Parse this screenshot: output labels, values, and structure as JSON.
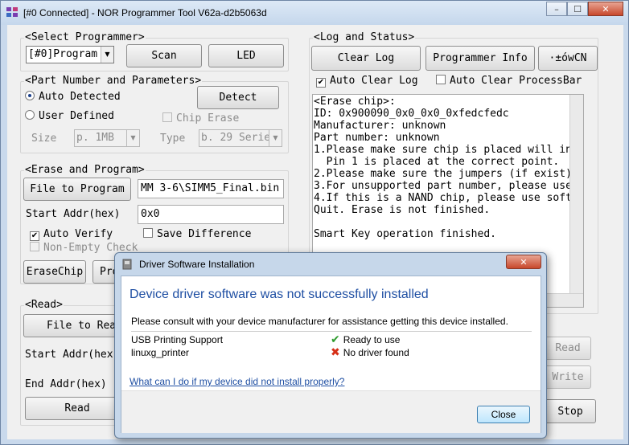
{
  "window": {
    "title": "[#0 Connected] - NOR Programmer Tool V62a-d2b5063d",
    "minimize": "–",
    "maximize": "☐",
    "close": "✕"
  },
  "select_programmer": {
    "legend": "<Select Programmer>",
    "selected": "[#0]Program",
    "scan": "Scan",
    "led": "LED"
  },
  "part": {
    "legend": "<Part Number and Parameters>",
    "auto_detected": "Auto Detected",
    "detect": "Detect",
    "user_defined": "User Defined",
    "chip_erase": "Chip Erase",
    "size_label": "Size",
    "size_value": "p. 1MB",
    "type_label": "Type",
    "type_value": "b. 29 Serie"
  },
  "erase_program": {
    "legend": "<Erase and Program>",
    "file_to_program": "File to Program",
    "file_path": "MM 3-6\\SIMM5_Final.bin",
    "start_addr_label": "Start Addr(hex)",
    "start_addr_value": "0x0",
    "auto_verify": "Auto Verify",
    "save_difference": "Save Difference",
    "non_empty_check": "Non-Empty Check",
    "erase_chip": "EraseChip",
    "program": "Pro"
  },
  "read": {
    "legend": "<Read>",
    "file_to_read": "File to Rea",
    "start_addr_label": "Start Addr(hex",
    "end_addr_label": "End Addr(hex)",
    "read": "Read"
  },
  "log": {
    "legend": "<Log and Status>",
    "clear_log": "Clear Log",
    "programmer_info": "Programmer Info",
    "garbled_button": "·±ówCN",
    "auto_clear_log": "Auto Clear Log",
    "auto_clear_processbar": "Auto Clear ProcessBar",
    "lines": [
      "<Erase chip>:",
      "ID: 0x900090_0x0_0x0_0xfedcfedc",
      "Manufacturer: unknown",
      "Part number: unknown",
      "1.Please make sure chip is placed will in",
      "  Pin 1 is placed at the correct point.",
      "2.Please make sure the jumpers (if exist)",
      "3.For unsupported part number, please use",
      "4.If this is a NAND chip, please use soft",
      "Quit. Erase is not finished.",
      "",
      "Smart Key operation finished."
    ]
  },
  "side_buttons": {
    "read": "Read",
    "write": "Write",
    "stop": "Stop"
  },
  "dialog": {
    "title": "Driver Software Installation",
    "close": "✕",
    "heading": "Device driver software was not successfully installed",
    "message": "Please consult with your device manufacturer for assistance getting this device installed.",
    "devices": [
      {
        "name": "USB Printing Support",
        "status": "Ready to use",
        "ok": true
      },
      {
        "name": "linuxg_printer",
        "status": "No driver found",
        "ok": false
      }
    ],
    "link": "What can I do if my device did not install properly?",
    "close_button": "Close"
  }
}
